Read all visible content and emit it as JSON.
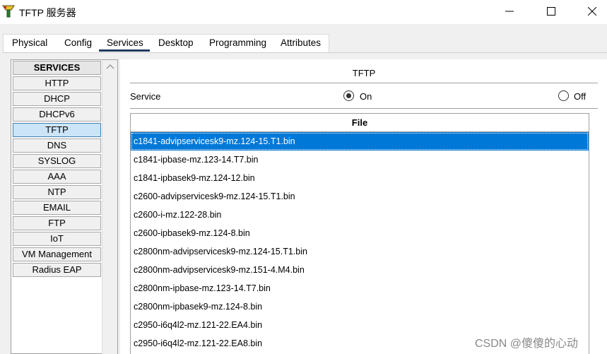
{
  "window": {
    "title": "TFTP 服务器",
    "minimize_glyph": "—",
    "maximize_glyph": "☐",
    "close_glyph": "✕"
  },
  "tabs": [
    {
      "label": "Physical",
      "active": false
    },
    {
      "label": "Config",
      "active": false
    },
    {
      "label": "Services",
      "active": true
    },
    {
      "label": "Desktop",
      "active": false
    },
    {
      "label": "Programming",
      "active": false
    },
    {
      "label": "Attributes",
      "active": false
    }
  ],
  "services_header": "SERVICES",
  "services": [
    {
      "label": "HTTP"
    },
    {
      "label": "DHCP"
    },
    {
      "label": "DHCPv6"
    },
    {
      "label": "TFTP",
      "selected": true
    },
    {
      "label": "DNS"
    },
    {
      "label": "SYSLOG"
    },
    {
      "label": "AAA"
    },
    {
      "label": "NTP"
    },
    {
      "label": "EMAIL"
    },
    {
      "label": "FTP"
    },
    {
      "label": "IoT"
    },
    {
      "label": "VM Management"
    },
    {
      "label": "Radius EAP"
    }
  ],
  "tftp": {
    "title": "TFTP",
    "service_label": "Service",
    "on_label": "On",
    "off_label": "Off",
    "selected": "On"
  },
  "file_table": {
    "header": "File",
    "rows": [
      "c1841-advipservicesk9-mz.124-15.T1.bin",
      "c1841-ipbase-mz.123-14.T7.bin",
      "c1841-ipbasek9-mz.124-12.bin",
      "c2600-advipservicesk9-mz.124-15.T1.bin",
      "c2600-i-mz.122-28.bin",
      "c2600-ipbasek9-mz.124-8.bin",
      "c2800nm-advipservicesk9-mz.124-15.T1.bin",
      "c2800nm-advipservicesk9-mz.151-4.M4.bin",
      "c2800nm-ipbase-mz.123-14.T7.bin",
      "c2800nm-ipbasek9-mz.124-8.bin",
      "c2950-i6q4l2-mz.121-22.EA4.bin",
      "c2950-i6q4l2-mz.121-22.EA8.bin"
    ],
    "selected_index": 0
  },
  "watermark": "CSDN @傻傻的心动",
  "colors": {
    "selection": "#0078d7",
    "active_tab_underline": "#1f3a5f",
    "service_selected_bg": "#cce4f7"
  }
}
